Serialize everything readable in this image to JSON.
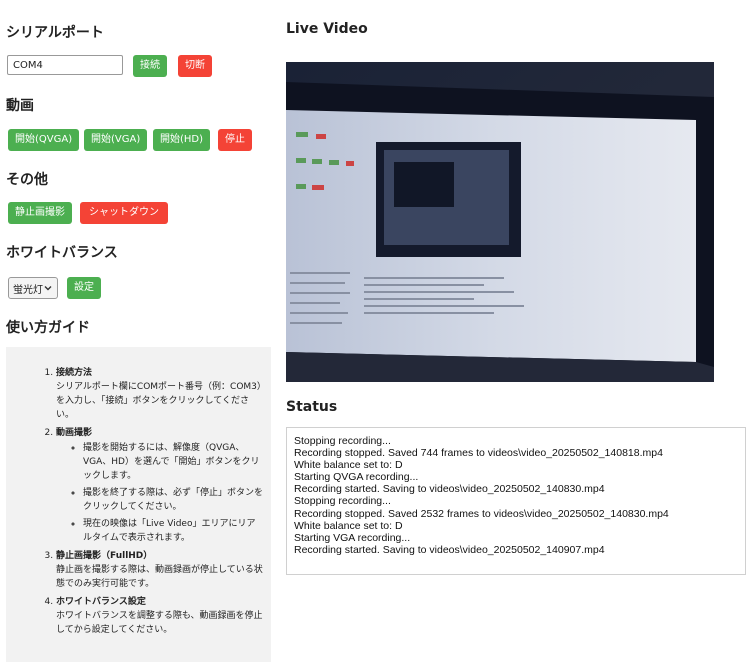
{
  "serial": {
    "title": "シリアルポート",
    "port_value": "COM4",
    "connect_label": "接続",
    "disconnect_label": "切断"
  },
  "video_controls": {
    "title": "動画",
    "qvga_label": "開始(QVGA)",
    "vga_label": "開始(VGA)",
    "hd_label": "開始(HD)",
    "stop_label": "停止"
  },
  "other": {
    "title": "その他",
    "still_label": "静止画撮影",
    "shutdown_label": "シャットダウン"
  },
  "white_balance": {
    "title": "ホワイトバランス",
    "selected": "蛍光灯",
    "set_label": "設定"
  },
  "guide": {
    "title": "使い方ガイド",
    "step1": {
      "title": "接続方法",
      "text": "シリアルポート欄にCOMポート番号（例：COM3）を入力し、「接続」ボタンをクリックしてください。"
    },
    "step2": {
      "title": "動画撮影",
      "bullets": [
        "撮影を開始するには、解像度（QVGA、VGA、HD）を選んで「開始」ボタンをクリックします。",
        "撮影を終了する際は、必ず「停止」ボタンをクリックしてください。",
        "現在の映像は「Live Video」エリアにリアルタイムで表示されます。"
      ]
    },
    "step3": {
      "title": "静止画撮影（FullHD）",
      "text": "静止画を撮影する際は、動画録画が停止している状態でのみ実行可能です。"
    },
    "step4": {
      "title": "ホワイトバランス設定",
      "text": "ホワイトバランスを調整する際も、動画録画を停止してから設定してください。"
    }
  },
  "live_video": {
    "title": "Live Video"
  },
  "status": {
    "title": "Status",
    "lines": [
      "Stopping recording...",
      "Recording stopped. Saved 744 frames to videos\\video_20250502_140818.mp4",
      "White balance set to: D",
      "Starting QVGA recording...",
      "Recording started. Saving to videos\\video_20250502_140830.mp4",
      "Stopping recording...",
      "Recording stopped. Saved 2532 frames to videos\\video_20250502_140830.mp4",
      "White balance set to: D",
      "Starting VGA recording...",
      "Recording started. Saving to videos\\video_20250502_140907.mp4"
    ]
  },
  "colors": {
    "green_button": "#4caf50",
    "red_button": "#f44336",
    "guide_background": "#f2f2f2"
  },
  "icons": {
    "select_arrow": "chevron-down-icon"
  }
}
